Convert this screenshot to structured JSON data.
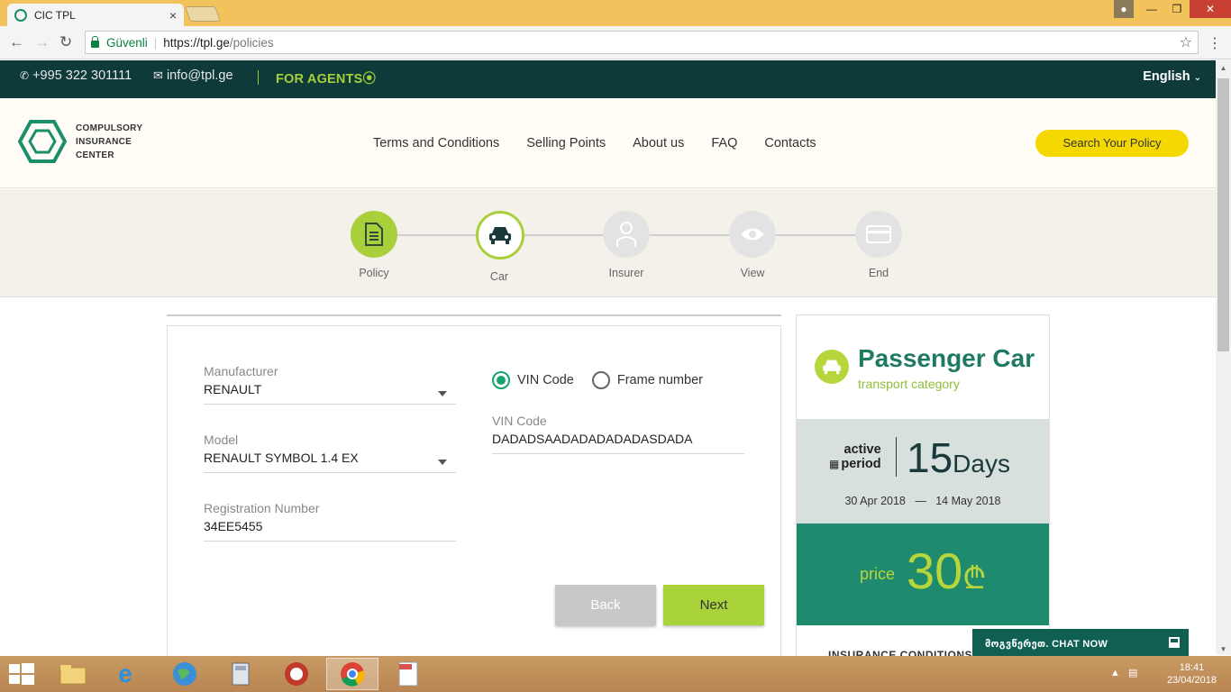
{
  "browser": {
    "tab_title": "CIC TPL",
    "tab_close": "×",
    "secure_label": "Güvenli",
    "url_host": "https://tpl.ge",
    "url_path": "/policies"
  },
  "topbar": {
    "phone": "+995 322 301111",
    "email": "info@tpl.ge",
    "agents": "FOR AGENTS",
    "language": "English"
  },
  "header": {
    "logo_line1": "COMPULSORY",
    "logo_line2": "INSURANCE",
    "logo_line3": "CENTER",
    "nav": [
      "Terms and Conditions",
      "Selling Points",
      "About us",
      "FAQ",
      "Contacts"
    ],
    "search_button": "Search Your Policy"
  },
  "stepper": {
    "steps": [
      {
        "label": "Policy",
        "icon": "document-icon",
        "state": "done"
      },
      {
        "label": "Car",
        "icon": "car-icon",
        "state": "active"
      },
      {
        "label": "Insurer",
        "icon": "person-icon",
        "state": "pending"
      },
      {
        "label": "View",
        "icon": "eye-icon",
        "state": "pending"
      },
      {
        "label": "End",
        "icon": "card-icon",
        "state": "pending"
      }
    ]
  },
  "form": {
    "manufacturer_label": "Manufacturer",
    "manufacturer_value": "RENAULT",
    "model_label": "Model",
    "model_value": "RENAULT SYMBOL 1.4 EX",
    "reg_label": "Registration Number",
    "reg_value": "34EE5455",
    "radio_vin": "VIN Code",
    "radio_frame": "Frame number",
    "selected_radio": "VIN Code",
    "vin_label": "VIN Code",
    "vin_value": "DADADSAADADADADADASDADA",
    "back": "Back",
    "next": "Next"
  },
  "summary": {
    "title": "Passenger Car",
    "subtitle": "transport category",
    "period_line1": "active",
    "period_line2": "period",
    "days_num": "15",
    "days_unit": "Days",
    "date_from": "30 Apr 2018",
    "date_sep": "—",
    "date_to": "14 May 2018",
    "price_label": "price",
    "price_value": "30",
    "currency": "₾",
    "conditions": "INSURANCE CONDITIONS"
  },
  "chat": {
    "label": "მოგვწერეთ. CHAT NOW"
  },
  "taskbar": {
    "time": "18:41",
    "date": "23/04/2018"
  },
  "colors": {
    "brand_green": "#1e8a6e",
    "lime": "#a9cf3b",
    "topbar": "#0e3a3a",
    "search_yellow": "#f5d800"
  }
}
